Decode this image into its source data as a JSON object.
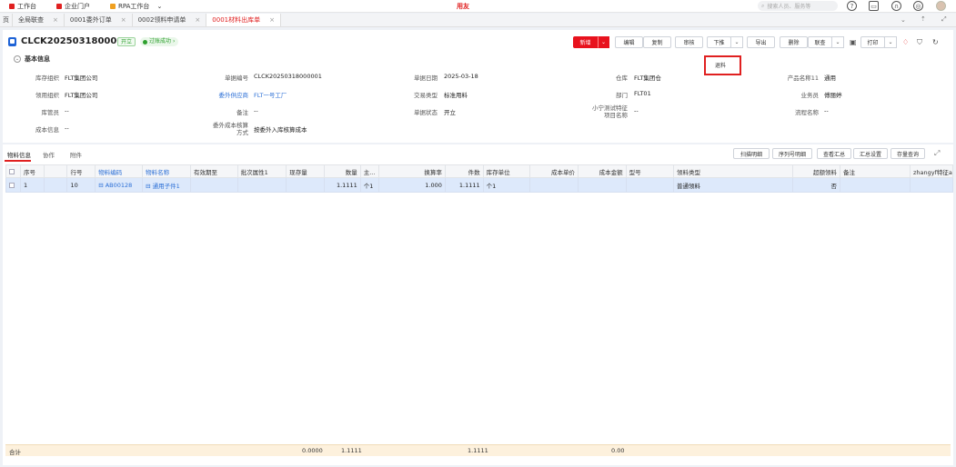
{
  "topbar": {
    "items": [
      "工作台",
      "企业门户",
      "RPA工作台"
    ],
    "logo": "用友",
    "search_placeholder": "搜索人员、服务等"
  },
  "tabs": [
    {
      "label": "页"
    },
    {
      "label": "全局联查"
    },
    {
      "label": "0001委外订单"
    },
    {
      "label": "0002领料申请单"
    },
    {
      "label": "0001材料出库单",
      "active": true
    }
  ],
  "header": {
    "doc_no": "CLCK20250318000001",
    "status_badge": "开立",
    "check_badge": "过账成功",
    "buttons": {
      "new": "新增",
      "edit": "编辑",
      "copy": "复制",
      "audit": "审核",
      "push_down": "下推",
      "export": "导出",
      "delete": "删除",
      "link_query": "联查",
      "print": "打印"
    },
    "popup_item": "退料",
    "section_title": "基本信息"
  },
  "fields": {
    "org_label": "库存组织",
    "org_value": "FLT集团公司",
    "docno_label": "单据编号",
    "docno_value": "CLCK20250318000001",
    "date_label": "单据日期",
    "date_value": "2025-03-18",
    "wh_label": "仓库",
    "wh_value": "FLT集团仓",
    "prod_label": "产品名称11",
    "prod_value": "通用",
    "use_org_label": "领用组织",
    "use_org_value": "FLT集团公司",
    "supplier_label": "委外供应商",
    "supplier_value": "FLT一号工厂",
    "trans_label": "交易类型",
    "trans_value": "标准用料",
    "dept_label": "部门",
    "dept_value": "FLT01",
    "staff_label": "业务员",
    "staff_value": "傅丽婷",
    "keeper_label": "库管员",
    "keeper_value": "--",
    "remark_label": "备注",
    "remark_value": "--",
    "docstatus_label": "单据状态",
    "docstatus_value": "开立",
    "test_label_1": "小宁测试特征",
    "test_label_2": "项目名称",
    "test_value": "--",
    "flow_label": "流程名称",
    "flow_value": "--",
    "cost_label": "成本信息",
    "cost_value": "--",
    "outcost_label_1": "委外成本核算",
    "outcost_label_2": "方式",
    "outcost_value": "按委外入库核算成本"
  },
  "grid": {
    "subtabs": [
      "物料信息",
      "协作",
      "附件"
    ],
    "buttons": [
      "扫描明细",
      "序列号明细",
      "查看汇总",
      "汇总设置",
      "存量查询"
    ],
    "headers": [
      "序号",
      "行号",
      "物料编码",
      "物料名称",
      "有效期至",
      "批次属性1",
      "现存量",
      "数量",
      "主...",
      "换算率",
      "件数",
      "库存单位",
      "成本单价",
      "成本金额",
      "型号",
      "领料类型",
      "超额领料",
      "备注",
      "zhangyf特征a"
    ],
    "rows": [
      {
        "seq": "1",
        "line": "10",
        "code": "AB00128",
        "name": "通用子件1",
        "expiry": "",
        "batch": "",
        "stock": "",
        "qty": "1.1111",
        "main_unit": "个1",
        "rate": "1.000",
        "pieces": "1.1111",
        "unit": "个1",
        "cost_price": "",
        "cost_amount": "",
        "model": "",
        "type": "普通领料",
        "excess": "否",
        "remark": "",
        "feature": ""
      }
    ],
    "totals": {
      "label": "合计",
      "stock": "0.0000",
      "qty": "1.1111",
      "pieces": "1.1111",
      "amount": "0.00"
    }
  }
}
